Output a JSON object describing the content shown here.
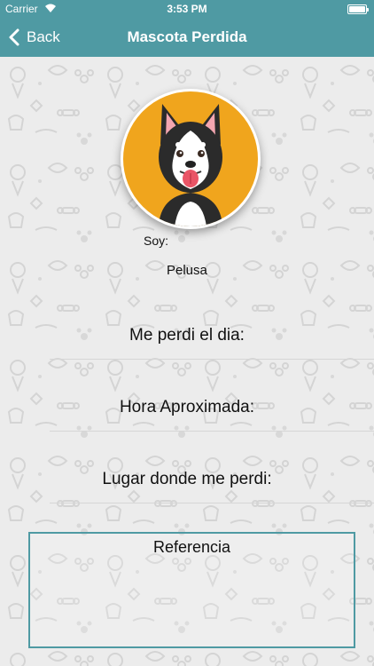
{
  "status_bar": {
    "carrier": "Carrier",
    "time": "3:53 PM"
  },
  "nav": {
    "back_label": "Back",
    "title": "Mascota Perdida"
  },
  "pet": {
    "soy_label": "Soy:",
    "name": "Pelusa"
  },
  "fields": {
    "date_label": "Me perdi el dia:",
    "time_label": "Hora Aproximada:",
    "place_label": "Lugar donde me perdi:"
  },
  "reference": {
    "label": "Referencia"
  },
  "colors": {
    "accent": "#4f9aa3",
    "avatar_bg": "#f0a51d",
    "background": "#ececec"
  }
}
